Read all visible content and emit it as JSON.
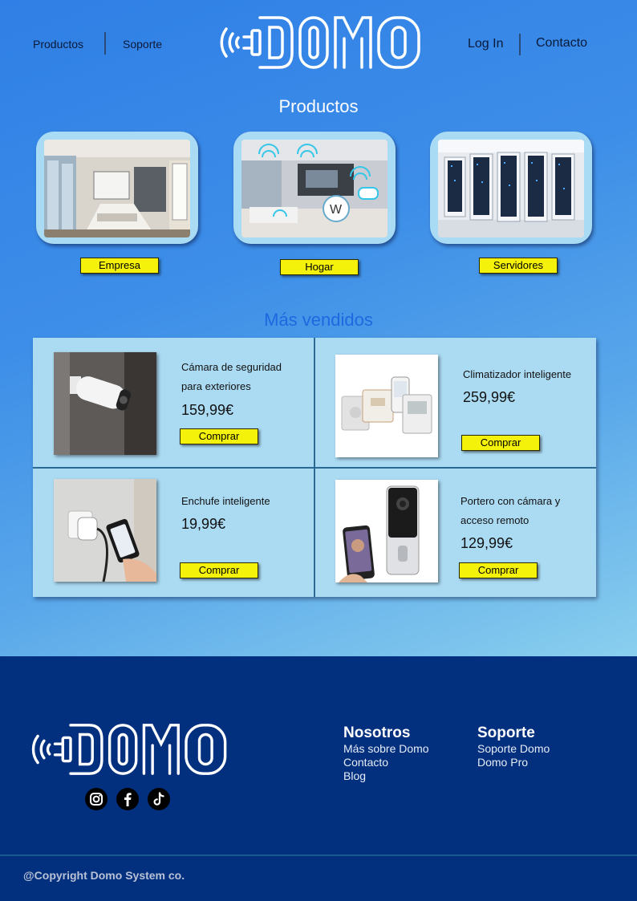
{
  "header": {
    "nav_left": [
      "Productos",
      "Soporte"
    ],
    "nav_right": [
      "Log In",
      "Contacto"
    ],
    "logo_text": "DOMO"
  },
  "products": {
    "title": "Productos",
    "categories": [
      {
        "label": "Empresa",
        "image": "conference-room-photo"
      },
      {
        "label": "Hogar",
        "image": "smart-home-living-room-photo"
      },
      {
        "label": "Servidores",
        "image": "server-racks-photo"
      }
    ]
  },
  "bestsellers": {
    "title": "Más vendidos",
    "items": [
      {
        "name_lines": [
          "Cámara de seguridad",
          "para exteriores"
        ],
        "price": "159,99€",
        "button": "Comprar",
        "image": "security-camera-photo"
      },
      {
        "name_lines": [
          "Climatizador inteligente"
        ],
        "price": "259,99€",
        "button": "Comprar",
        "image": "thermostat-photo"
      },
      {
        "name_lines": [
          "Enchufe inteligente"
        ],
        "price": "19,99€",
        "button": "Comprar",
        "image": "smart-plug-photo"
      },
      {
        "name_lines": [
          "Portero con cámara y",
          "acceso remoto"
        ],
        "price": "129,99€",
        "button": "Comprar",
        "image": "video-doorbell-photo"
      }
    ]
  },
  "footer": {
    "logo_text": "DOMO",
    "social": [
      "instagram-icon",
      "facebook-icon",
      "tiktok-icon"
    ],
    "columns": [
      {
        "heading": "Nosotros",
        "links": [
          "Más sobre Domo",
          "Contacto",
          "Blog"
        ]
      },
      {
        "heading": "Soporte",
        "links": [
          "Soporte Domo",
          "Domo Pro"
        ]
      }
    ],
    "copyright": "@Copyright Domo System co."
  },
  "colors": {
    "accent_yellow": "#f4f20b",
    "footer_bg": "#03307e",
    "card_bg": "#abdbf3",
    "section_title_blue": "#1f68e0"
  }
}
